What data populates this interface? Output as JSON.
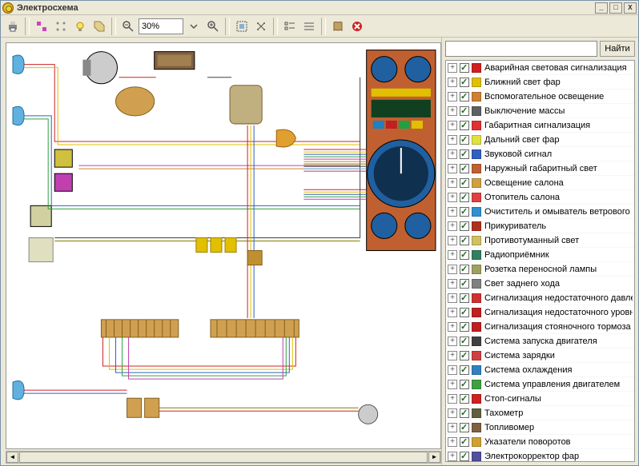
{
  "window": {
    "title": "Электросхема"
  },
  "toolbar": {
    "zoom_value": "30%"
  },
  "search": {
    "placeholder": "",
    "button_label": "Найти"
  },
  "circuits": [
    {
      "label": "Аварийная световая сигнализация",
      "color": "#d02020"
    },
    {
      "label": "Ближний свет фар",
      "color": "#e0c000"
    },
    {
      "label": "Вспомогательное освещение",
      "color": "#d08030"
    },
    {
      "label": "Выключение массы",
      "color": "#606060"
    },
    {
      "label": "Габаритная сигнализация",
      "color": "#e03030"
    },
    {
      "label": "Дальний свет фар",
      "color": "#e0e040"
    },
    {
      "label": "Звуковой сигнал",
      "color": "#3060c0"
    },
    {
      "label": "Наружный габаритный свет",
      "color": "#c06030"
    },
    {
      "label": "Освещение салона",
      "color": "#d0a040"
    },
    {
      "label": "Отопитель салона",
      "color": "#e04040"
    },
    {
      "label": "Очиститель и омыватель ветрового стекла",
      "color": "#3090d0"
    },
    {
      "label": "Прикуриватель",
      "color": "#b03020"
    },
    {
      "label": "Противотуманный свет",
      "color": "#d0c060"
    },
    {
      "label": "Радиоприёмник",
      "color": "#308060"
    },
    {
      "label": "Розетка переносной лампы",
      "color": "#a0a060"
    },
    {
      "label": "Свет заднего хода",
      "color": "#808080"
    },
    {
      "label": "Сигнализация недостаточного давления масла",
      "color": "#d03030"
    },
    {
      "label": "Сигнализация недостаточного уровня тормозной жидкости",
      "color": "#c02020"
    },
    {
      "label": "Сигнализация стояночного тормоза",
      "color": "#c02020"
    },
    {
      "label": "Система запуска двигателя",
      "color": "#404040"
    },
    {
      "label": "Система зарядки",
      "color": "#d04040"
    },
    {
      "label": "Система охлаждения",
      "color": "#3080c0"
    },
    {
      "label": "Система управления двигателем",
      "color": "#40a040"
    },
    {
      "label": "Стоп-сигналы",
      "color": "#d02020"
    },
    {
      "label": "Тахометр",
      "color": "#606040"
    },
    {
      "label": "Топливомер",
      "color": "#806040"
    },
    {
      "label": "Указатели поворотов",
      "color": "#d0a030"
    },
    {
      "label": "Электрокорректор фар",
      "color": "#5050a0"
    }
  ]
}
